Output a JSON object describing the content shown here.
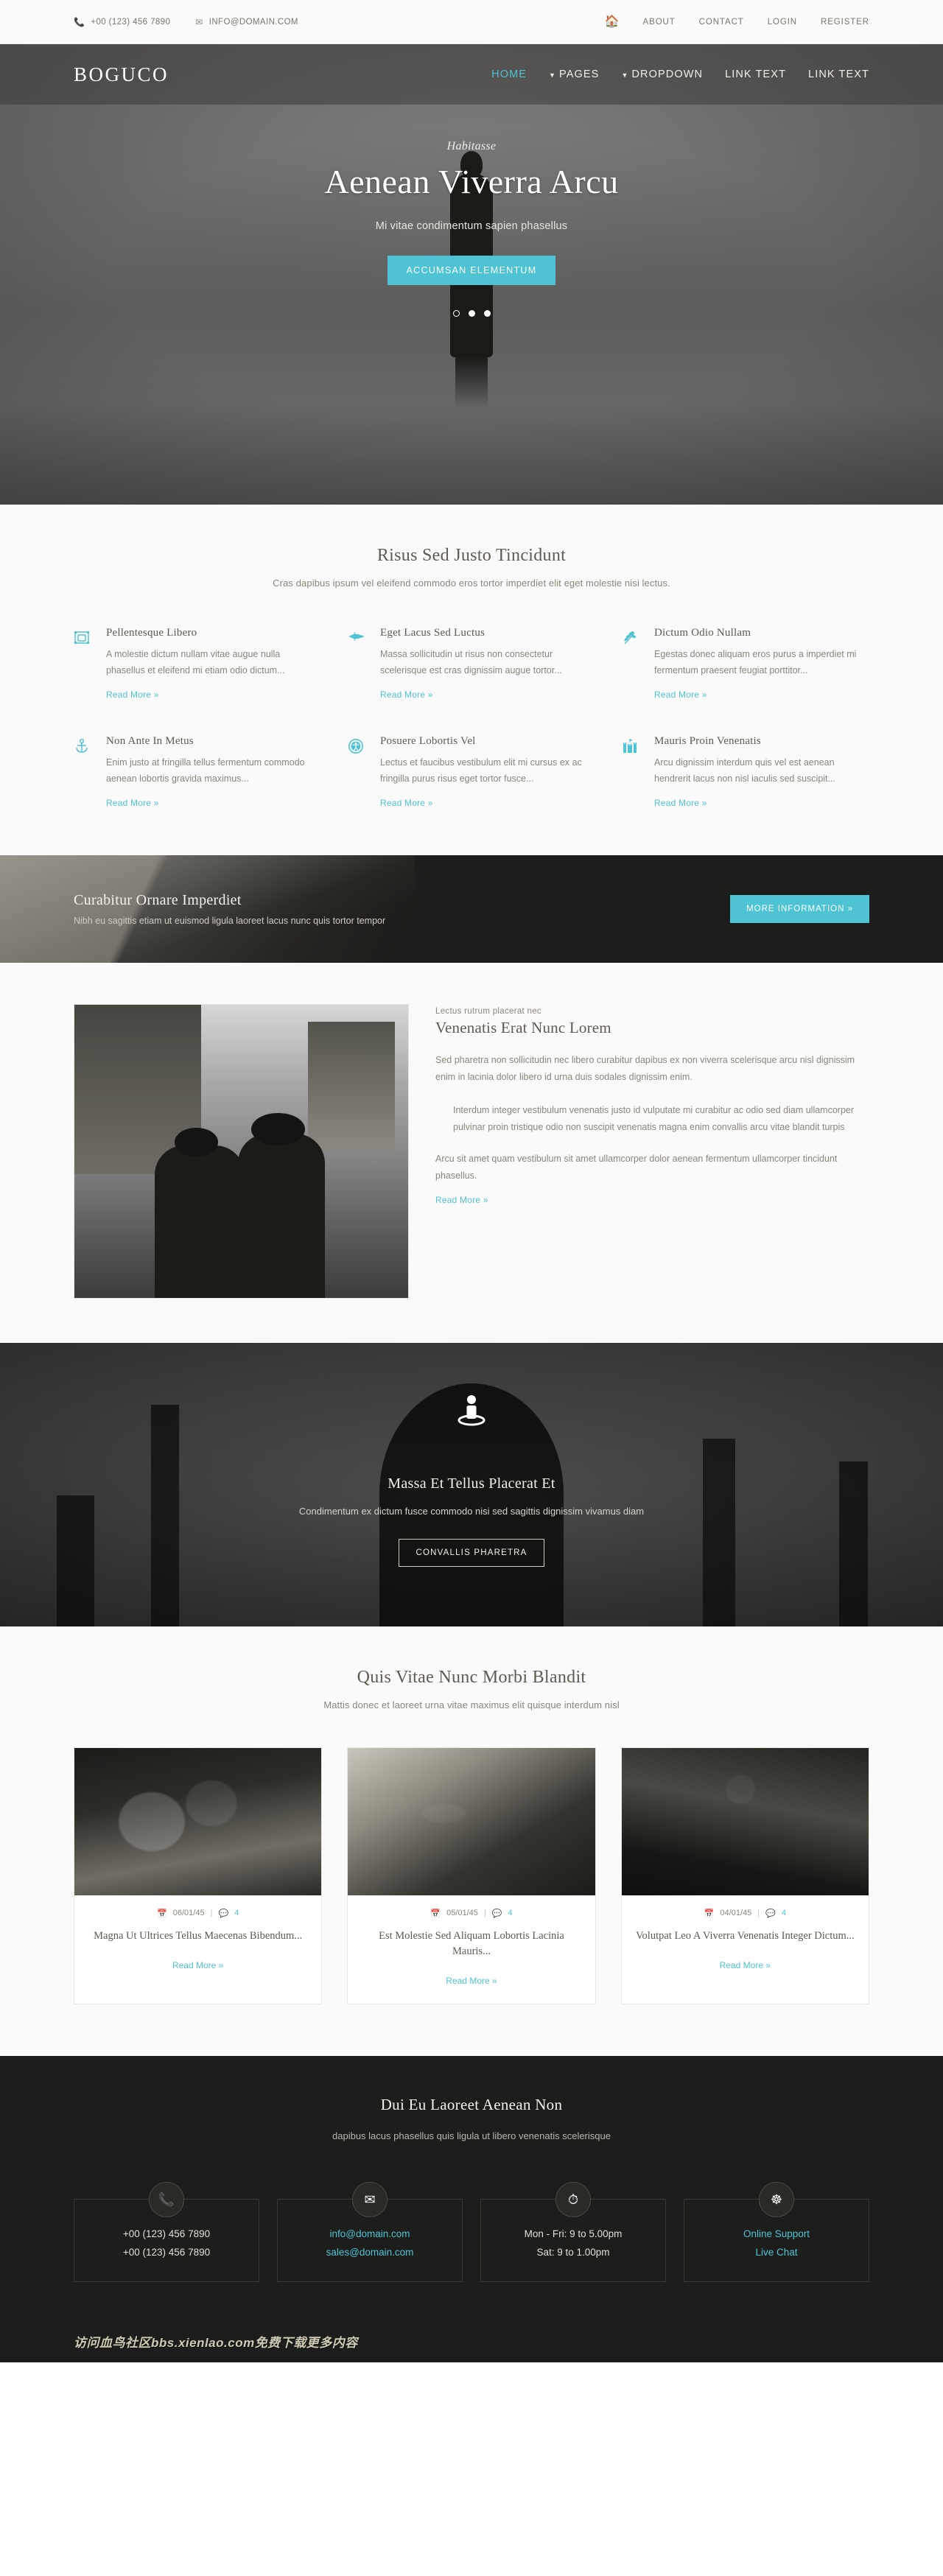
{
  "topbar": {
    "phone": "+00 (123) 456 7890",
    "phone_icon": "phone-icon",
    "email": "INFO@DOMAIN.COM",
    "email_icon": "envelope-icon",
    "home_icon": "home-icon",
    "links": [
      {
        "label": "ABOUT"
      },
      {
        "label": "CONTACT"
      },
      {
        "label": "LOGIN"
      },
      {
        "label": "REGISTER"
      }
    ]
  },
  "nav": {
    "brand": "BOGUCO",
    "items": [
      {
        "label": "HOME",
        "active": true,
        "caret": false
      },
      {
        "label": "PAGES",
        "active": false,
        "caret": true
      },
      {
        "label": "DROPDOWN",
        "active": false,
        "caret": true
      },
      {
        "label": "LINK TEXT",
        "active": false,
        "caret": false
      },
      {
        "label": "LINK TEXT",
        "active": false,
        "caret": false
      }
    ]
  },
  "hero": {
    "kicker": "Habitasse",
    "title": "Aenean Viverra Arcu",
    "subtitle": "Mi vitae condimentum sapien phasellus",
    "cta_label": "ACCUMSAN ELEMENTUM",
    "slides": 3,
    "active_slide": 1
  },
  "services": {
    "title": "Risus Sed Justo Tincidunt",
    "lead": "Cras dapibus ipsum vel eleifend commodo eros tortor imperdiet elit eget molestie nisi lectus.",
    "read_more": "Read More »",
    "items": [
      {
        "icon": "frame-image-icon",
        "title": "Pellentesque Libero",
        "text": "A molestie dictum nullam vitae augue nulla phasellus et eleifend mi etiam odio dictum..."
      },
      {
        "icon": "jet-plane-icon",
        "title": "Eget Lacus Sed Luctus",
        "text": "Massa sollicitudin ut risus non consectetur scelerisque est cras dignissim augue tortor..."
      },
      {
        "icon": "leaf-branch-icon",
        "title": "Dictum Odio Nullam",
        "text": "Egestas donec aliquam eros purus a imperdiet mi fermentum praesent feugiat porttitor..."
      },
      {
        "icon": "anchor-icon",
        "title": "Non Ante In Metus",
        "text": "Enim justo at fringilla tellus fermentum commodo aenean lobortis gravida maximus..."
      },
      {
        "icon": "accessibility-icon",
        "title": "Posuere Lobortis Vel",
        "text": "Lectus et faucibus vestibulum elit mi cursus ex ac fringilla purus risus eget tortor fusce..."
      },
      {
        "icon": "castle-icon",
        "title": "Mauris Proin Venenatis",
        "text": "Arcu dignissim interdum quis vel est aenean hendrerit lacus non nisl iaculis sed suscipit..."
      }
    ]
  },
  "cta_banner": {
    "title": "Curabitur Ornare Imperdiet",
    "subtitle": "Nibh eu sagittis etiam ut euismod ligula laoreet lacus nunc quis tortor tempor",
    "button_label": "MORE INFORMATION »"
  },
  "article": {
    "image_alt": "two-people-street-photo",
    "kicker": "Lectus rutrum placerat nec",
    "title": "Venenatis Erat Nunc Lorem",
    "paragraph1": "Sed pharetra non sollicitudin nec libero curabitur dapibus ex non viverra scelerisque arcu nisl dignissim enim in lacinia dolor libero id urna duis sodales dignissim enim.",
    "quote": "Interdum integer vestibulum venenatis justo id vulputate mi curabitur ac odio sed diam ullamcorper pulvinar proin tristique odio non suscipit venenatis magna enim convallis arcu vitae blandit turpis",
    "paragraph2": "Arcu sit amet quam vestibulum sit amet ullamcorper dolor aenean fermentum ullamcorper tincidunt phasellus.",
    "read_more": "Read More »"
  },
  "parallax": {
    "icon": "person-pedestal-icon",
    "title": "Massa Et Tellus Placerat Et",
    "subtitle": "Condimentum ex dictum fusce commodo nisi sed sagittis dignissim vivamus diam",
    "button_label": "CONVALLIS PHARETRA"
  },
  "blog": {
    "title": "Quis Vitae Nunc Morbi Blandit",
    "lead": "Mattis donec et laoreet urna vitae maximus elit quisque interdum nisl",
    "read_more": "Read More »",
    "calendar_icon": "calendar-icon",
    "comment_icon": "comment-icon",
    "posts": [
      {
        "date": "06/01/45",
        "comments": "4",
        "title": "Magna Ut Ultrices Tellus Maecenas Bibendum...",
        "image_alt": "white-flowers-photo"
      },
      {
        "date": "05/01/45",
        "comments": "4",
        "title": "Est Molestie Sed Aliquam Lobortis Lacinia Mauris...",
        "image_alt": "bird-silhouette-photo"
      },
      {
        "date": "04/01/45",
        "comments": "4",
        "title": "Volutpat Leo A Viverra Venenatis Integer Dictum...",
        "image_alt": "crowd-concert-photo"
      }
    ]
  },
  "footer": {
    "title": "Dui Eu Laoreet Aenean Non",
    "subtitle": "dapibus lacus phasellus quis ligula ut libero venenatis scelerisque",
    "cards": [
      {
        "icon": "phone-icon",
        "line1": "+00 (123) 456 7890",
        "line2": "+00 (123) 456 7890",
        "link": false
      },
      {
        "icon": "envelope-icon",
        "line1": "info@domain.com",
        "line2": "sales@domain.com",
        "link": true
      },
      {
        "icon": "clock-icon",
        "line1": "Mon - Fri: 9 to 5.00pm",
        "line2": "Sat: 9 to 1.00pm",
        "link": false
      },
      {
        "icon": "lifebuoy-icon",
        "line1": "Online Support",
        "line2": "Live Chat",
        "link": true
      }
    ],
    "watermark": "访问血鸟社区bbs.xienlao.com免费下载更多内容"
  },
  "colors": {
    "accent": "#4ec3d4",
    "dark": "#1d1d1b",
    "body_bg": "#fafafa",
    "text": "#8a867a",
    "heading": "#5f5b51"
  }
}
